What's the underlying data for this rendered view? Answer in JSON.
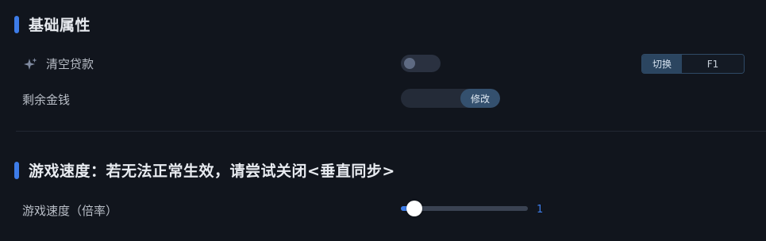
{
  "sections": {
    "basic": {
      "title": "基础属性"
    },
    "speed": {
      "title": "游戏速度：若无法正常生效，请尝试关闭<垂直同步>"
    }
  },
  "rows": {
    "clear_loan": {
      "label": "清空贷款",
      "icon": "sparkle-icon",
      "toggle_on": false,
      "hotkey": {
        "mode_label": "切换",
        "key": "F1"
      }
    },
    "remaining_money": {
      "label": "剩余金钱",
      "input_value": "",
      "button_label": "修改"
    },
    "game_speed": {
      "label": "游戏速度（倍率）",
      "slider_fraction": 0.1,
      "value": "1"
    }
  },
  "colors": {
    "accent": "#3d7ce8",
    "background": "#11151d"
  }
}
